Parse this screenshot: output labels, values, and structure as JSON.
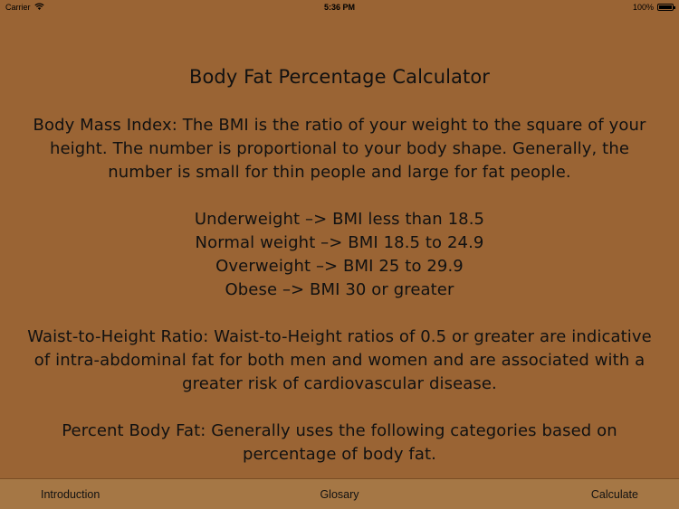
{
  "status_bar": {
    "carrier": "Carrier",
    "time": "5:36 PM",
    "battery_label": "100%",
    "battery_level": 1.0,
    "icons": [
      "wifi-icon",
      "battery-icon"
    ]
  },
  "content": {
    "title": "Body Fat Percentage Calculator",
    "bmi_paragraph": [
      "Body Mass Index: The BMI is the ratio of your weight to the square of your",
      "height. The number is proportional to your body shape. Generally, the",
      "number is small for thin people and large for fat people."
    ],
    "bmi_categories": [
      "Underweight –> BMI less than 18.5",
      "Normal weight –> BMI 18.5 to 24.9",
      "Overweight –> BMI 25 to 29.9",
      "Obese –> BMI 30 or greater"
    ],
    "whr_paragraph": [
      "Waist-to-Height Ratio: Waist-to-Height ratios of 0.5 or greater are indicative",
      "of intra-abdominal fat for both men and women and are associated with a",
      "greater risk of cardiovascular disease."
    ],
    "pbf_paragraph": [
      "Percent Body Fat: Generally uses the following categories based on",
      "percentage of body fat."
    ]
  },
  "tab_bar": {
    "tabs": [
      {
        "label": "Introduction"
      },
      {
        "label": "Glosary"
      },
      {
        "label": "Calculate"
      }
    ]
  },
  "colors": {
    "background": "#9a6434",
    "tab_bar": "#a57745",
    "text": "#111111"
  }
}
